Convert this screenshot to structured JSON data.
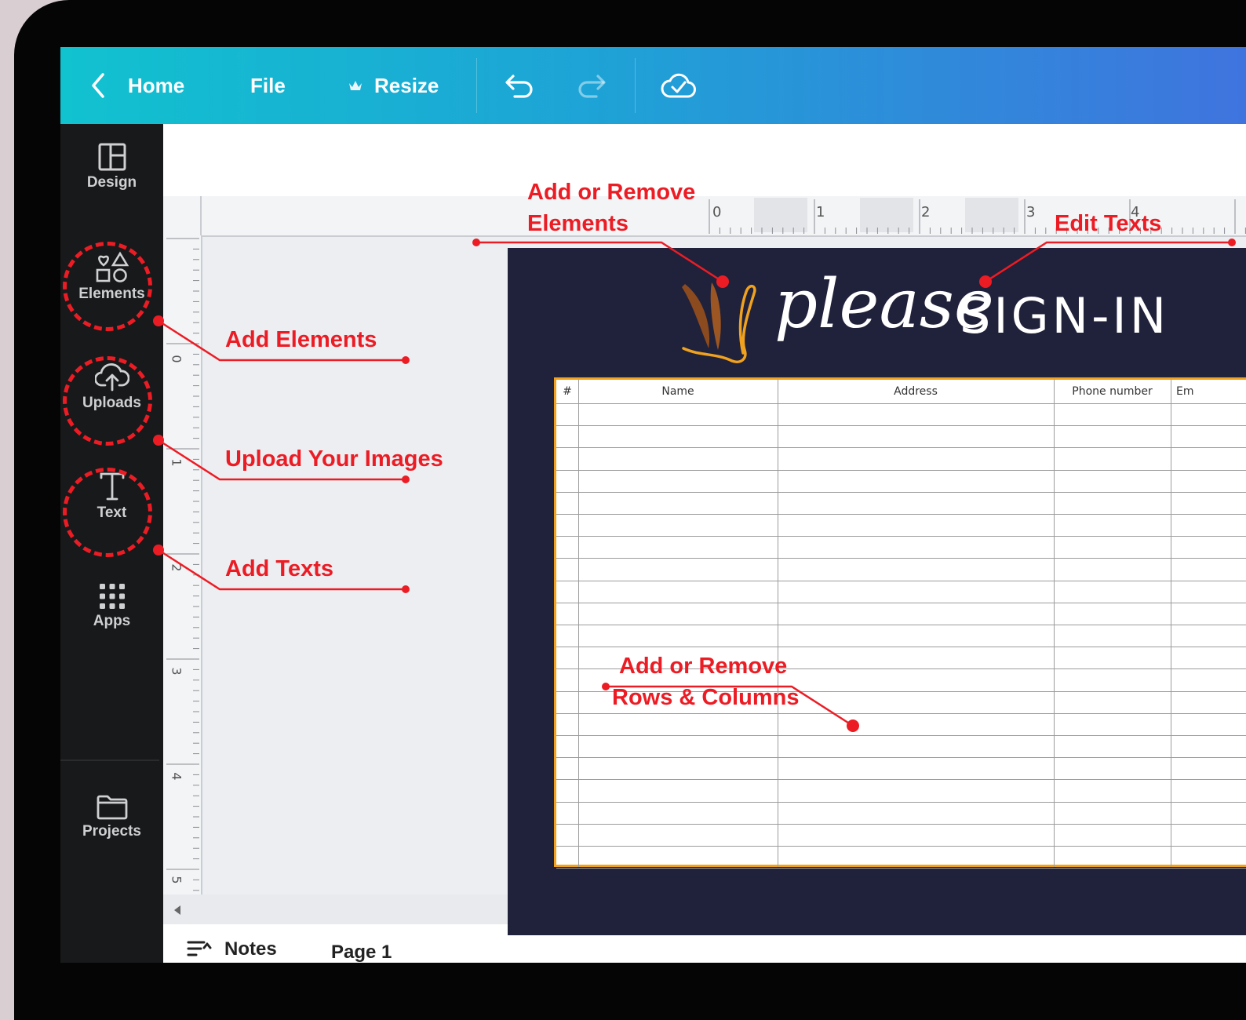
{
  "topbar": {
    "home_label": "Home",
    "file_label": "File",
    "resize_label": "Resize"
  },
  "sidebar": {
    "items": [
      {
        "label": "Design",
        "icon": "layout-icon"
      },
      {
        "label": "Elements",
        "icon": "shapes-icon"
      },
      {
        "label": "Uploads",
        "icon": "cloud-upload-icon"
      },
      {
        "label": "Text",
        "icon": "text-t-icon"
      },
      {
        "label": "Apps",
        "icon": "grid-icon"
      },
      {
        "label": "Projects",
        "icon": "folder-icon"
      }
    ]
  },
  "ruler": {
    "h_ticks": [
      "0",
      "1",
      "2",
      "3",
      "4"
    ],
    "v_ticks": [
      "0",
      "1",
      "2",
      "3",
      "4",
      "5"
    ]
  },
  "design": {
    "script_text": "please",
    "title": "SIGN-IN",
    "table_headers": [
      "#",
      "Name",
      "Address",
      "Phone number",
      "Em"
    ]
  },
  "footer": {
    "notes_label": "Notes",
    "page_label": "Page 1"
  },
  "annotations": {
    "add_remove_elements_line1": "Add or Remove",
    "add_remove_elements_line2": "Elements",
    "edit_texts": "Edit Texts",
    "add_elements": "Add Elements",
    "upload_images": "Upload Your Images",
    "add_texts": "Add Texts",
    "add_remove_rows_line1": "Add or Remove",
    "add_remove_rows_line2": "Rows & Columns"
  },
  "colors": {
    "annotation_red": "#ec1c24",
    "table_border": "#f0a21f",
    "canvas_navy": "#20213a"
  }
}
